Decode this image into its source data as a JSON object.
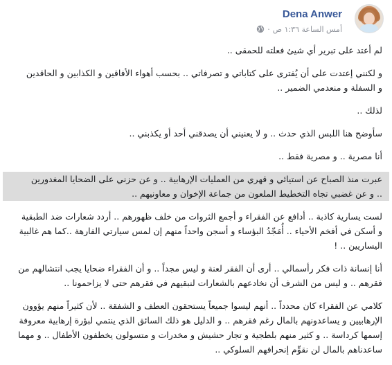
{
  "post": {
    "author": "Dena Anwer",
    "timestamp": "أمس الساعة ١:٣٦ ص",
    "dot": "·",
    "paragraphs": [
      [
        "لم أعتد على تبرير أي شيئ فعلته للحمقى .."
      ],
      [
        "و لكنني إعتدت على أن يُفترى على كتاباتي و تصرفاتي .. بحسب أهواء الأفاقين و الكذابين و الحاقدين",
        "و السفلة و منعدمي الضمير .."
      ],
      [
        "لذلك .."
      ],
      [
        "سأوضح هنا اللبس الذي حدث .. و لا يعنيني أن يصدقني أحد أو يكذبني .."
      ],
      [
        "أنا مصرية .. و مصرية فقط .."
      ],
      [
        "عبرت منذ الصباح عن استيائي و قهري من العمليات الإرهابية .. و عن حزني على الضحايا المغدورين",
        ".. و عن غضبي تجاه التخطيط الملعون من جماعة الإخوان و معاونيهم .."
      ],
      [
        "لست يسارية كاذبة .. أدافع عن الفقراء و أجمع الثروات من خلف ظهورهم .. أردد شعارات ضد الطبقية",
        "و أسكن في أفخم الأحياء .. أُمَجّدُ البؤساء و أسجن واحداً منهم إن لمس سيارتي الفارهة ..كما هم غالبية",
        "اليساريين .. !"
      ],
      [
        "أنا إنسانة ذات فكر رأسمالي .. أرى أن الفقر لعنة و ليس مجداً .. و أن الفقراء ضحايا يجب انتشالهم من",
        "فقرهم .. و ليس من الشرف أن نخادعهم بالشعارات لنبقيهم في فقرهم حتى لا يزاحمونا .."
      ],
      [
        "كلامي عن الفقراء كان محدداً .. أنهم ليسوا جميعاً يستحقون العطف و الشفقة .. لأن كثيراً منهم يؤوون",
        "الإرهابيين و يساعدونهم بالمال رغم فقرهم .. و الدليل هو ذلك السائق الذي ينتمي لبؤرة إرهابية معروفة",
        "إسمها كرداسة .. و كثير منهم بلطجية و تجار حشيش و مخدرات و متسولون يخطفون الأطفال .. و مهما",
        "ساعدناهم بالمال لن نقوِّم إنحرافهم السلوكي .."
      ]
    ]
  },
  "icons": {
    "privacy": "globe-icon"
  },
  "colors": {
    "author": "#385898",
    "meta": "#90949c",
    "highlight": "#dcdcdc"
  }
}
